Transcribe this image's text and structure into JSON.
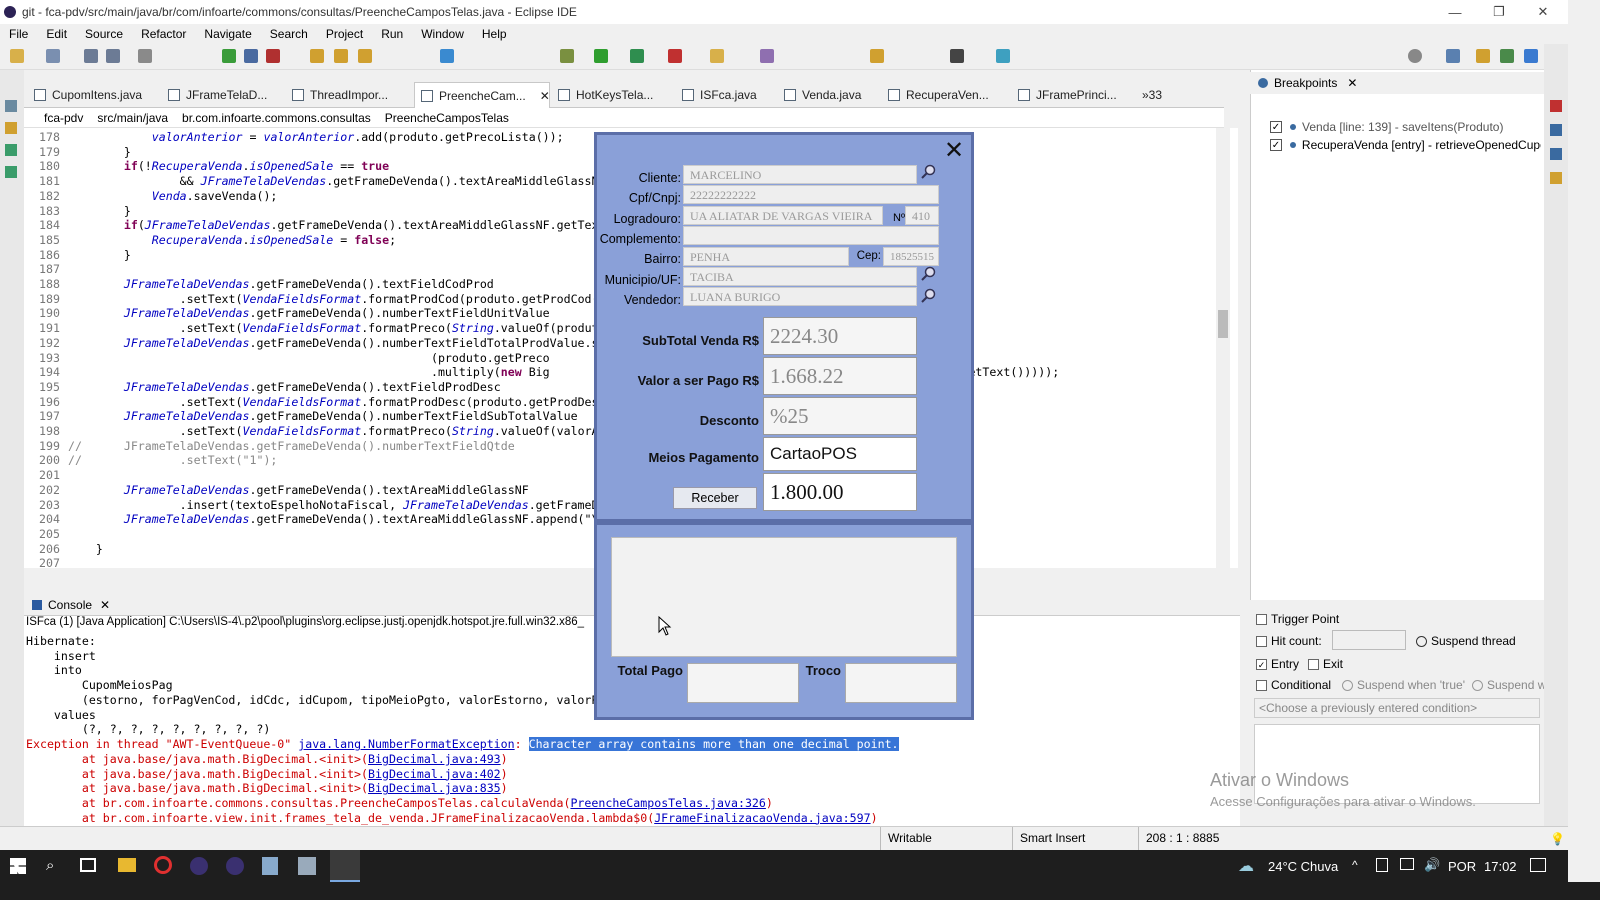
{
  "window": {
    "title": "git - fca-pdv/src/main/java/br/com/infoarte/commons/consultas/PreencheCamposTelas.java - Eclipse IDE"
  },
  "menu": [
    "File",
    "Edit",
    "Source",
    "Refactor",
    "Navigate",
    "Search",
    "Project",
    "Run",
    "Window",
    "Help"
  ],
  "tabs": [
    {
      "label": "CupomItens.java"
    },
    {
      "label": "JFrameTelaD..."
    },
    {
      "label": "ThreadImpor..."
    },
    {
      "label": "PreencheCam...",
      "close": "✕"
    },
    {
      "label": "HotKeysTela..."
    },
    {
      "label": "ISFca.java"
    },
    {
      "label": "Venda.java"
    },
    {
      "label": "RecuperaVen..."
    },
    {
      "label": "JFramePrinci..."
    },
    {
      "label": "»33"
    }
  ],
  "breadcrumb": [
    "fca-pdv",
    "src/main/java",
    "br.com.infoarte.commons.consultas",
    "PreencheCamposTelas"
  ],
  "code_lines": [
    {
      "n": "178",
      "t": "            valorAnterior = valorAnterior.add(produto.getPrecoLista());"
    },
    {
      "n": "179",
      "t": "        }"
    },
    {
      "n": "180",
      "t": "        if(!RecuperaVenda.isOpenedSale == true"
    },
    {
      "n": "181",
      "t": "                && JFrameTelaDeVendas.getFrameDeVenda().textAreaMiddleGlassNF"
    },
    {
      "n": "182",
      "t": "            Venda.saveVenda();"
    },
    {
      "n": "183",
      "t": "        }"
    },
    {
      "n": "184",
      "t": "        if(JFrameTelaDeVendas.getFrameDeVenda().textAreaMiddleGlassNF.getText"
    },
    {
      "n": "185",
      "t": "            RecuperaVenda.isOpenedSale = false;"
    },
    {
      "n": "186",
      "t": "        }"
    },
    {
      "n": "187",
      "t": ""
    },
    {
      "n": "188",
      "t": "        JFrameTelaDeVendas.getFrameDeVenda().textFieldCodProd"
    },
    {
      "n": "189",
      "t": "                .setText(VendaFieldsFormat.formatProdCod(produto.getProdCod()"
    },
    {
      "n": "190",
      "t": "        JFrameTelaDeVendas.getFrameDeVenda().numberTextFieldUnitValue"
    },
    {
      "n": "191",
      "t": "                .setText(VendaFieldsFormat.formatPreco(String.valueOf(produto"
    },
    {
      "n": "192",
      "t": "        JFrameTelaDeVendas.getFrameDeVenda().numberTextFieldTotalProdValue.se"
    },
    {
      "n": "193",
      "t": "                                                    (produto.getPreco"
    },
    {
      "n": "194",
      "t": "                                                    .multiply(new Big                                                 FieldQtde.getText()))));"
    },
    {
      "n": "195",
      "t": "        JFrameTelaDeVendas.getFrameDeVenda().textFieldProdDesc"
    },
    {
      "n": "196",
      "t": "                .setText(VendaFieldsFormat.formatProdDesc(produto.getProdDesc"
    },
    {
      "n": "197",
      "t": "        JFrameTelaDeVendas.getFrameDeVenda().numberTextFieldSubTotalValue"
    },
    {
      "n": "198",
      "t": "                .setText(VendaFieldsFormat.formatPreco(String.valueOf(valorAn"
    },
    {
      "n": "199",
      "t": "//      JFrameTelaDeVendas.getFrameDeVenda().numberTextFieldQtde"
    },
    {
      "n": "200",
      "t": "//              .setText(\"1\");"
    },
    {
      "n": "201",
      "t": ""
    },
    {
      "n": "202",
      "t": "        JFrameTelaDeVendas.getFrameDeVenda().textAreaMiddleGlassNF"
    },
    {
      "n": "203",
      "t": "                .insert(textoEspelhoNotaFiscal, JFrameTelaDeVendas.getFrameDe"
    },
    {
      "n": "204",
      "t": "        JFrameTelaDeVendas.getFrameDeVenda().textAreaMiddleGlassNF.append(\"\\r"
    },
    {
      "n": "205",
      "t": ""
    },
    {
      "n": "206",
      "t": "    }"
    },
    {
      "n": "207",
      "t": ""
    }
  ],
  "console": {
    "tab": "Console",
    "launch": "ISFca (1) [Java Application] C:\\Users\\IS-4\\.p2\\pool\\plugins\\org.eclipse.justj.openjdk.hotspot.jre.full.win32.x86_",
    "lines": [
      "Hibernate:",
      "    insert",
      "    into",
      "        CupomMeiosPag",
      "        (estorno, forPagVenCod, idCdc, idCupom, tipoMeioPgto, valorEstorno, valorPa",
      "    values",
      "        (?, ?, ?, ?, ?, ?, ?, ?, ?)"
    ],
    "exception_prefix": "Exception in thread \"AWT-EventQueue-0\" ",
    "exception_class": "java.lang.NumberFormatException",
    "exception_msg": "Character array contains more than one decimal point.",
    "stack": [
      {
        "pre": "        at java.base/java.math.BigDecimal.<init>(",
        "link": "BigDecimal.java:493",
        "post": ")"
      },
      {
        "pre": "        at java.base/java.math.BigDecimal.<init>(",
        "link": "BigDecimal.java:402",
        "post": ")"
      },
      {
        "pre": "        at java.base/java.math.BigDecimal.<init>(",
        "link": "BigDecimal.java:835",
        "post": ")"
      },
      {
        "pre": "        at br.com.infoarte.commons.consultas.PreencheCamposTelas.calculaVenda(",
        "link": "PreencheCamposTelas.java:326",
        "post": ")"
      },
      {
        "pre": "        at br.com.infoarte.view.init.frames_tela_de_venda.JFrameFinalizacaoVenda.lambda$0(",
        "link": "JFrameFinalizacaoVenda.java:597",
        "post": ")"
      }
    ]
  },
  "breakpoints": {
    "title": "Breakpoints",
    "items": [
      "Venda [line: 139] - saveItens(Produto)",
      "RecuperaVenda [entry] - retrieveOpenedCupor"
    ],
    "trigger_point": "Trigger Point",
    "hit_count": "Hit count:",
    "suspend_thread": "Suspend thread",
    "entry": "Entry",
    "exit": "Exit",
    "conditional": "Conditional",
    "suspend_true": "Suspend when 'true'",
    "suspend_w": "Suspend w",
    "condition_placeholder": "<Choose a previously entered condition>"
  },
  "watermark": {
    "line1": "Ativar o Windows",
    "line2": "Acesse Configurações para ativar o Windows."
  },
  "status": {
    "writable": "Writable",
    "insert": "Smart Insert",
    "position": "208 : 1 : 8885"
  },
  "taskbar": {
    "weather": "24°C Chuva",
    "lang": "POR",
    "time": "17:02"
  },
  "dialog": {
    "close": "✕",
    "fields": [
      {
        "label": "Cliente:",
        "value": "MARCELINO"
      },
      {
        "label": "Cpf/Cnpj:",
        "value": "22222222222"
      },
      {
        "label": "Logradouro:",
        "value": "UA ALIATAR DE VARGAS VIEIRA"
      },
      {
        "label": "Complemento:",
        "value": ""
      },
      {
        "label": "Bairro:",
        "value": "PENHA"
      },
      {
        "label": "Municipio/UF:",
        "value": "TACIBA"
      },
      {
        "label": "Vendedor:",
        "value": "LUANA BURIGO"
      }
    ],
    "numero_label": "Nº",
    "numero": "410",
    "cep_label": "Cep:",
    "cep": "18525515",
    "subtotal_label": "SubTotal Venda R$",
    "subtotal": "2224.30",
    "valor_label": "Valor a ser Pago R$",
    "valor": "1.668.22",
    "desconto_label": "Desconto",
    "desconto": "%25",
    "meios_label": "Meios Pagamento",
    "meios": "CartaoPOS",
    "receber": "Receber",
    "receber_value": "1.800.00",
    "total_pago": "Total Pago",
    "troco": "Troco"
  }
}
